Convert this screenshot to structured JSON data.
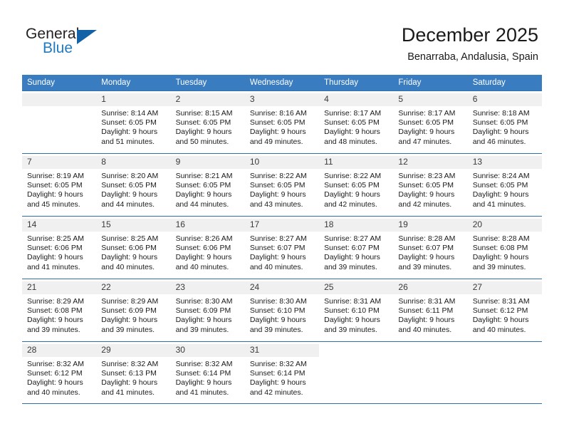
{
  "brand": {
    "name_part1": "General",
    "name_part2": "Blue",
    "accent_color": "#1362a8",
    "blue_text_color": "#1f7ac4"
  },
  "header": {
    "title": "December 2025",
    "subtitle": "Benarraba, Andalusia, Spain"
  },
  "calendar": {
    "header_bg": "#3a7cc0",
    "weekdays": [
      "Sunday",
      "Monday",
      "Tuesday",
      "Wednesday",
      "Thursday",
      "Friday",
      "Saturday"
    ],
    "weeks": [
      [
        {
          "day": "",
          "sunrise": "",
          "sunset": "",
          "daylight1": "",
          "daylight2": "",
          "blank": true
        },
        {
          "day": "1",
          "sunrise": "Sunrise: 8:14 AM",
          "sunset": "Sunset: 6:05 PM",
          "daylight1": "Daylight: 9 hours",
          "daylight2": "and 51 minutes."
        },
        {
          "day": "2",
          "sunrise": "Sunrise: 8:15 AM",
          "sunset": "Sunset: 6:05 PM",
          "daylight1": "Daylight: 9 hours",
          "daylight2": "and 50 minutes."
        },
        {
          "day": "3",
          "sunrise": "Sunrise: 8:16 AM",
          "sunset": "Sunset: 6:05 PM",
          "daylight1": "Daylight: 9 hours",
          "daylight2": "and 49 minutes."
        },
        {
          "day": "4",
          "sunrise": "Sunrise: 8:17 AM",
          "sunset": "Sunset: 6:05 PM",
          "daylight1": "Daylight: 9 hours",
          "daylight2": "and 48 minutes."
        },
        {
          "day": "5",
          "sunrise": "Sunrise: 8:17 AM",
          "sunset": "Sunset: 6:05 PM",
          "daylight1": "Daylight: 9 hours",
          "daylight2": "and 47 minutes."
        },
        {
          "day": "6",
          "sunrise": "Sunrise: 8:18 AM",
          "sunset": "Sunset: 6:05 PM",
          "daylight1": "Daylight: 9 hours",
          "daylight2": "and 46 minutes."
        }
      ],
      [
        {
          "day": "7",
          "sunrise": "Sunrise: 8:19 AM",
          "sunset": "Sunset: 6:05 PM",
          "daylight1": "Daylight: 9 hours",
          "daylight2": "and 45 minutes."
        },
        {
          "day": "8",
          "sunrise": "Sunrise: 8:20 AM",
          "sunset": "Sunset: 6:05 PM",
          "daylight1": "Daylight: 9 hours",
          "daylight2": "and 44 minutes."
        },
        {
          "day": "9",
          "sunrise": "Sunrise: 8:21 AM",
          "sunset": "Sunset: 6:05 PM",
          "daylight1": "Daylight: 9 hours",
          "daylight2": "and 44 minutes."
        },
        {
          "day": "10",
          "sunrise": "Sunrise: 8:22 AM",
          "sunset": "Sunset: 6:05 PM",
          "daylight1": "Daylight: 9 hours",
          "daylight2": "and 43 minutes."
        },
        {
          "day": "11",
          "sunrise": "Sunrise: 8:22 AM",
          "sunset": "Sunset: 6:05 PM",
          "daylight1": "Daylight: 9 hours",
          "daylight2": "and 42 minutes."
        },
        {
          "day": "12",
          "sunrise": "Sunrise: 8:23 AM",
          "sunset": "Sunset: 6:05 PM",
          "daylight1": "Daylight: 9 hours",
          "daylight2": "and 42 minutes."
        },
        {
          "day": "13",
          "sunrise": "Sunrise: 8:24 AM",
          "sunset": "Sunset: 6:05 PM",
          "daylight1": "Daylight: 9 hours",
          "daylight2": "and 41 minutes."
        }
      ],
      [
        {
          "day": "14",
          "sunrise": "Sunrise: 8:25 AM",
          "sunset": "Sunset: 6:06 PM",
          "daylight1": "Daylight: 9 hours",
          "daylight2": "and 41 minutes."
        },
        {
          "day": "15",
          "sunrise": "Sunrise: 8:25 AM",
          "sunset": "Sunset: 6:06 PM",
          "daylight1": "Daylight: 9 hours",
          "daylight2": "and 40 minutes."
        },
        {
          "day": "16",
          "sunrise": "Sunrise: 8:26 AM",
          "sunset": "Sunset: 6:06 PM",
          "daylight1": "Daylight: 9 hours",
          "daylight2": "and 40 minutes."
        },
        {
          "day": "17",
          "sunrise": "Sunrise: 8:27 AM",
          "sunset": "Sunset: 6:07 PM",
          "daylight1": "Daylight: 9 hours",
          "daylight2": "and 40 minutes."
        },
        {
          "day": "18",
          "sunrise": "Sunrise: 8:27 AM",
          "sunset": "Sunset: 6:07 PM",
          "daylight1": "Daylight: 9 hours",
          "daylight2": "and 39 minutes."
        },
        {
          "day": "19",
          "sunrise": "Sunrise: 8:28 AM",
          "sunset": "Sunset: 6:07 PM",
          "daylight1": "Daylight: 9 hours",
          "daylight2": "and 39 minutes."
        },
        {
          "day": "20",
          "sunrise": "Sunrise: 8:28 AM",
          "sunset": "Sunset: 6:08 PM",
          "daylight1": "Daylight: 9 hours",
          "daylight2": "and 39 minutes."
        }
      ],
      [
        {
          "day": "21",
          "sunrise": "Sunrise: 8:29 AM",
          "sunset": "Sunset: 6:08 PM",
          "daylight1": "Daylight: 9 hours",
          "daylight2": "and 39 minutes."
        },
        {
          "day": "22",
          "sunrise": "Sunrise: 8:29 AM",
          "sunset": "Sunset: 6:09 PM",
          "daylight1": "Daylight: 9 hours",
          "daylight2": "and 39 minutes."
        },
        {
          "day": "23",
          "sunrise": "Sunrise: 8:30 AM",
          "sunset": "Sunset: 6:09 PM",
          "daylight1": "Daylight: 9 hours",
          "daylight2": "and 39 minutes."
        },
        {
          "day": "24",
          "sunrise": "Sunrise: 8:30 AM",
          "sunset": "Sunset: 6:10 PM",
          "daylight1": "Daylight: 9 hours",
          "daylight2": "and 39 minutes."
        },
        {
          "day": "25",
          "sunrise": "Sunrise: 8:31 AM",
          "sunset": "Sunset: 6:10 PM",
          "daylight1": "Daylight: 9 hours",
          "daylight2": "and 39 minutes."
        },
        {
          "day": "26",
          "sunrise": "Sunrise: 8:31 AM",
          "sunset": "Sunset: 6:11 PM",
          "daylight1": "Daylight: 9 hours",
          "daylight2": "and 40 minutes."
        },
        {
          "day": "27",
          "sunrise": "Sunrise: 8:31 AM",
          "sunset": "Sunset: 6:12 PM",
          "daylight1": "Daylight: 9 hours",
          "daylight2": "and 40 minutes."
        }
      ],
      [
        {
          "day": "28",
          "sunrise": "Sunrise: 8:32 AM",
          "sunset": "Sunset: 6:12 PM",
          "daylight1": "Daylight: 9 hours",
          "daylight2": "and 40 minutes."
        },
        {
          "day": "29",
          "sunrise": "Sunrise: 8:32 AM",
          "sunset": "Sunset: 6:13 PM",
          "daylight1": "Daylight: 9 hours",
          "daylight2": "and 41 minutes."
        },
        {
          "day": "30",
          "sunrise": "Sunrise: 8:32 AM",
          "sunset": "Sunset: 6:14 PM",
          "daylight1": "Daylight: 9 hours",
          "daylight2": "and 41 minutes."
        },
        {
          "day": "31",
          "sunrise": "Sunrise: 8:32 AM",
          "sunset": "Sunset: 6:14 PM",
          "daylight1": "Daylight: 9 hours",
          "daylight2": "and 42 minutes."
        },
        {
          "day": "",
          "sunrise": "",
          "sunset": "",
          "daylight1": "",
          "daylight2": "",
          "empty": true
        },
        {
          "day": "",
          "sunrise": "",
          "sunset": "",
          "daylight1": "",
          "daylight2": "",
          "empty": true
        },
        {
          "day": "",
          "sunrise": "",
          "sunset": "",
          "daylight1": "",
          "daylight2": "",
          "empty": true
        }
      ]
    ]
  }
}
